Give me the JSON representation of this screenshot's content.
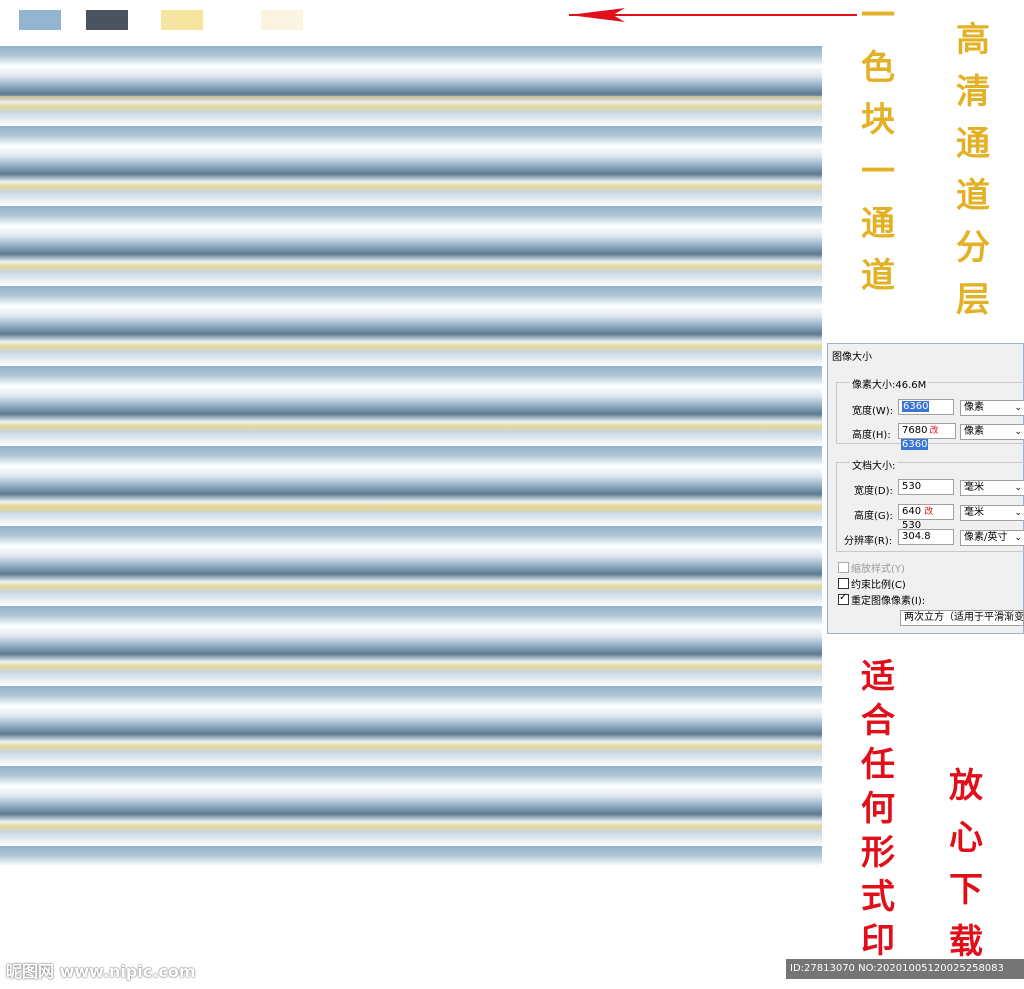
{
  "swatches": [
    "#93b5cf",
    "#4a5461",
    "#f6e4a1",
    "#fbf4e3"
  ],
  "annotations": {
    "one_color_one_channel": "一色块一通道",
    "hd_channel_layers": "高清通道分层",
    "suitable_any_print": "适合任何形式印",
    "download_with_confidence": "放心下载"
  },
  "dialog": {
    "title": "图像大小",
    "pixel_group_label": "像素大小:46.6M",
    "width_label": "宽度(W):",
    "width_value": "6360",
    "width_unit": "像素",
    "height_label": "高度(H):",
    "height_value_original": "7680",
    "height_annotation": "改",
    "height_value": "6360",
    "height_unit": "像素",
    "doc_group_label": "文档大小:",
    "doc_width_label": "宽度(D):",
    "doc_width_value": "530",
    "doc_width_unit": "毫米",
    "doc_height_label": "高度(G):",
    "doc_height_value": "640",
    "doc_height_annotation": "改",
    "doc_height_new": "530",
    "doc_height_unit": "毫米",
    "resolution_label": "分辨率(R):",
    "resolution_value": "304.8",
    "resolution_unit": "像素/英寸",
    "scale_styles_label": "缩放样式(Y)",
    "constrain_label": "约束比例(C)",
    "resample_label": "重定图像像素(I):",
    "resample_method": "两次立方（适用于平滑渐变"
  },
  "watermark": "昵图网 www.nipic.com",
  "image_id": "ID:27813070 NO:20201005120025258083"
}
